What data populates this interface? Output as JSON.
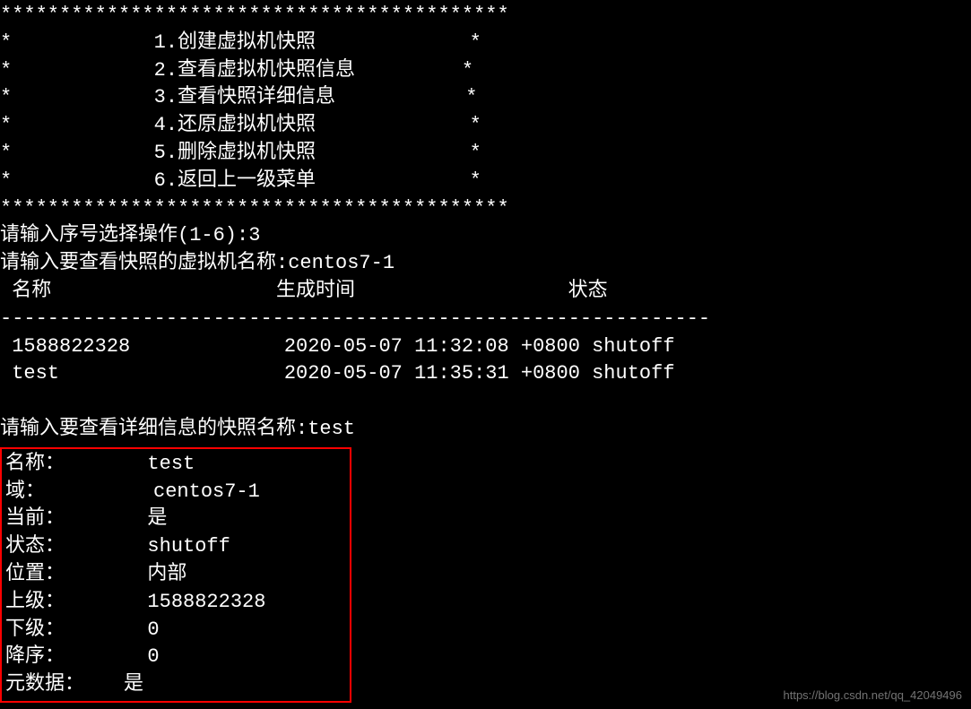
{
  "menu": {
    "border": "*******************************************",
    "items": [
      "*            1.创建虚拟机快照             *",
      "*            2.查看虚拟机快照信息         *",
      "*            3.查看快照详细信息           *",
      "*            4.还原虚拟机快照             *",
      "*            5.删除虚拟机快照             *",
      "*            6.返回上一级菜单             *"
    ]
  },
  "prompts": {
    "select_op": "请输入序号选择操作(1-6):3",
    "vm_name": "请输入要查看快照的虚拟机名称:centos7-1",
    "snapshot_name": "请输入要查看详细信息的快照名称:test"
  },
  "table": {
    "header": " 名称                   生成时间                  状态",
    "divider": "------------------------------------------------------------",
    "rows": [
      " 1588822328             2020-05-07 11:32:08 +0800 shutoff",
      " test                   2020-05-07 11:35:31 +0800 shutoff"
    ]
  },
  "details": {
    "name_label": "名称：",
    "name_value": "test",
    "domain_label": "域：",
    "domain_value": "centos7-1",
    "current_label": "当前：",
    "current_value": "是",
    "state_label": "状态：",
    "state_value": "shutoff",
    "location_label": "位置：",
    "location_value": "内部",
    "parent_label": "上级：",
    "parent_value": "1588822328",
    "children_label": "下级：",
    "children_value": "0",
    "descendants_label": "降序：",
    "descendants_value": "0",
    "metadata_label": "元数据：",
    "metadata_value": "是"
  },
  "watermark": "https://blog.csdn.net/qq_42049496"
}
